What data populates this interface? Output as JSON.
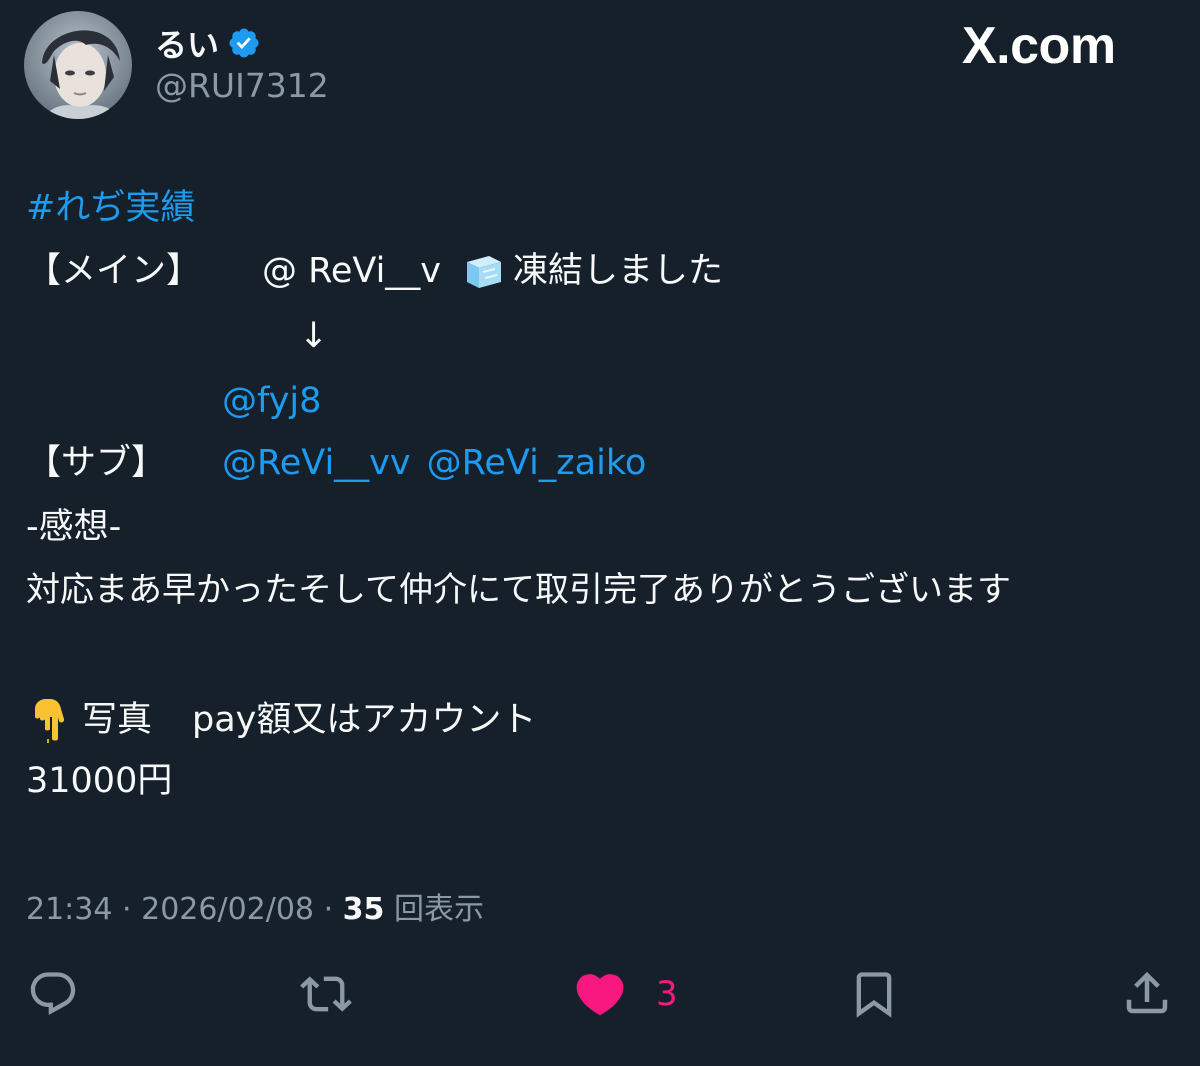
{
  "author": {
    "display_name": "るい",
    "handle": "@RUI7312",
    "verified": true
  },
  "site_logo": "X.com",
  "tweet": {
    "hashtag": "#れぢ実績",
    "main_label": "【メイン】",
    "main_mention": "@ ReVi__v",
    "main_status": "凍結しました",
    "arrow": "↓",
    "new_main": "@fyj8",
    "sub_label": "【サブ】",
    "sub_mention_1": "@ReVi__vv",
    "sub_mention_2": "@ReVi_zaiko",
    "impression_label": "-感想-",
    "impression_text": "対応まあ早かったそして仲介にて取引完了ありがとうございます",
    "photo_label": "写真",
    "pay_text": "pay額又はアカウント",
    "amount": "31000円"
  },
  "meta": {
    "time": "21:34",
    "date": "2026/02/08",
    "separator": "·",
    "views_count": "35",
    "views_label": "回表示"
  },
  "actions": {
    "like_count": "3"
  },
  "colors": {
    "background": "#15202b",
    "text": "#f7f9f9",
    "secondary": "#8b98a5",
    "link": "#1d9bf0",
    "like": "#f91880",
    "verified": "#1d9bf0"
  },
  "icons": [
    "avatar",
    "verified-badge-icon",
    "ice-cube-icon",
    "pointing-down-icon",
    "reply-icon",
    "retweet-icon",
    "heart-icon",
    "bookmark-icon",
    "share-icon"
  ]
}
